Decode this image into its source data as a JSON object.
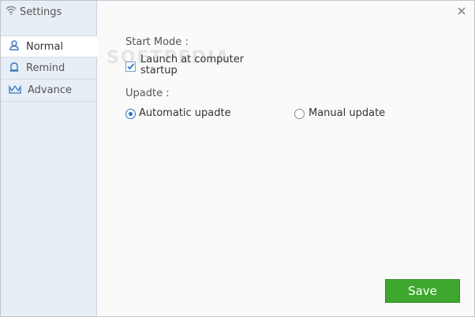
{
  "window": {
    "title": "Settings"
  },
  "sidebar": {
    "items": [
      {
        "label": "Normal",
        "icon": "person-icon",
        "active": true
      },
      {
        "label": "Remind",
        "icon": "alarm-icon",
        "active": false
      },
      {
        "label": "Advance",
        "icon": "crown-icon",
        "active": false
      }
    ]
  },
  "normal": {
    "start_mode_label": "Start Mode :",
    "launch_checkbox": {
      "label": "Launch at computer startup",
      "checked": true
    },
    "update_label": "Upadte :",
    "update_options": [
      {
        "label": "Automatic upadte",
        "selected": true
      },
      {
        "label": "Manual update",
        "selected": false
      }
    ]
  },
  "watermark": "SOFTPEDIA",
  "actions": {
    "save_label": "Save"
  },
  "colors": {
    "accent": "#2a73c9",
    "save_button": "#3ea82e",
    "sidebar_bg": "#e8eef5"
  }
}
